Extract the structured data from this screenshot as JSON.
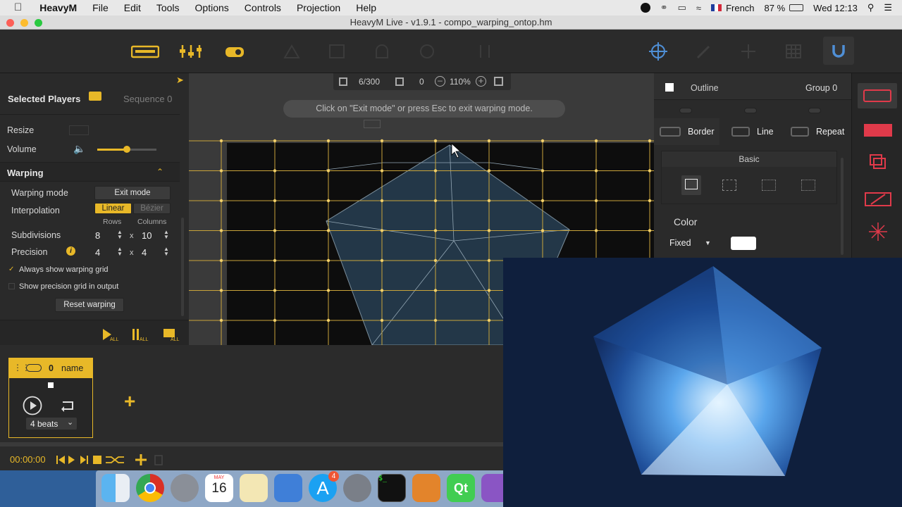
{
  "menubar": {
    "app": "HeavyM",
    "items": [
      "File",
      "Edit",
      "Tools",
      "Options",
      "Controls",
      "Projection",
      "Help"
    ],
    "language": "French",
    "battery": "87 %",
    "clock": "Wed 12:13"
  },
  "window": {
    "title": "HeavyM Live - v1.9.1 - compo_warping_ontop.hm"
  },
  "canvas_bar": {
    "count": "6/300",
    "zero": "0",
    "zoom": "110%"
  },
  "hint": "Click on \"Exit mode\" or press Esc to exit warping mode.",
  "left": {
    "tab_selected": "Selected Players",
    "tab_sequence": "Sequence 0",
    "resize_label": "Resize",
    "volume_label": "Volume",
    "volume_level": 0.5,
    "warping_title": "Warping",
    "warping_mode_label": "Warping mode",
    "exit_mode_btn": "Exit mode",
    "interpolation_label": "Interpolation",
    "linear": "Linear",
    "bezier": "Bézier",
    "rows_header": "Rows",
    "cols_header": "Columns",
    "subdivisions_label": "Subdivisions",
    "subdiv_rows": "8",
    "subdiv_cols": "10",
    "precision_label": "Precision",
    "prec_rows": "4",
    "prec_cols": "4",
    "x1": "x",
    "x2": "x",
    "always_show": "Always show warping grid",
    "show_precision": "Show precision grid in output",
    "reset_btn": "Reset warping"
  },
  "right": {
    "outline": "Outline",
    "group": "Group 0",
    "tab_border": "Border",
    "tab_line": "Line",
    "tab_repeat": "Repeat",
    "basic": "Basic",
    "color_label": "Color",
    "fixed": "Fixed",
    "color_swatch": "#ffffff"
  },
  "player": {
    "index": "0",
    "name": "name",
    "beats": "4 beats"
  },
  "transport": {
    "time": "00:00:00"
  },
  "dock": {
    "calendar_month": "MAY",
    "calendar_day": "16",
    "badge": "4"
  },
  "colors": {
    "accent": "#e8b828",
    "sidebar_red": "#e03a4a",
    "canvas_bg": "#3a3a3a"
  }
}
